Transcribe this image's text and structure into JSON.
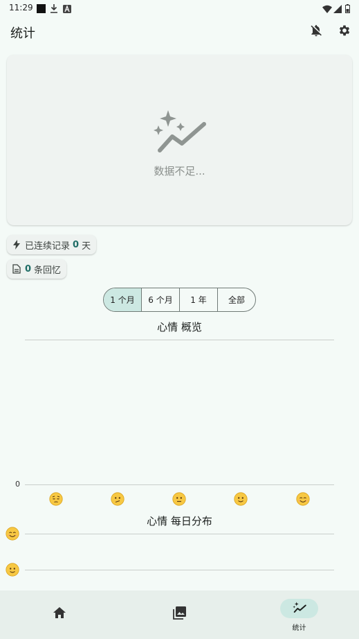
{
  "status_bar": {
    "time": "11:29",
    "icons": [
      "square-icon",
      "download-icon",
      "a-icon",
      "wifi-icon",
      "signal-icon",
      "battery-icon"
    ]
  },
  "app_bar": {
    "title": "统计",
    "actions": [
      "notifications-off-icon",
      "settings-icon"
    ]
  },
  "insufficient_card": {
    "icon": "insights-sparkle-icon",
    "message": "数据不足..."
  },
  "streak_chip": {
    "icon": "bolt-icon",
    "prefix": "已连续记录",
    "count": "0",
    "suffix": "天"
  },
  "memories_chip": {
    "icon": "document-icon",
    "count": "0",
    "suffix": "条回忆"
  },
  "range_selector": {
    "options": [
      "1 个月",
      "6 个月",
      "1 年",
      "全部"
    ],
    "selected": "1 个月"
  },
  "mood_overview": {
    "title": "心情 概览",
    "y_tick": "0",
    "moods": [
      "pensive-face",
      "confused-face",
      "neutral-face",
      "slight-smile-face",
      "happy-face"
    ]
  },
  "daily_distribution": {
    "title": "心情 每日分布",
    "rows": [
      "happy-face",
      "slight-smile-face"
    ]
  },
  "bottom_nav": {
    "items": [
      {
        "icon": "home-icon",
        "label": ""
      },
      {
        "icon": "gallery-icon",
        "label": ""
      },
      {
        "icon": "insights-icon",
        "label": "统计"
      }
    ],
    "active": "统计"
  },
  "colors": {
    "background": "#f4faf7",
    "accent": "#1f6d66",
    "selected": "#cce8e2",
    "emoji_face": "#f7c843"
  },
  "chart_data": [
    {
      "type": "bar",
      "title": "心情 概览",
      "categories": [
        "pensive-face",
        "confused-face",
        "neutral-face",
        "slight-smile-face",
        "happy-face"
      ],
      "values": [
        0,
        0,
        0,
        0,
        0
      ],
      "yticks": [
        "0"
      ]
    }
  ]
}
